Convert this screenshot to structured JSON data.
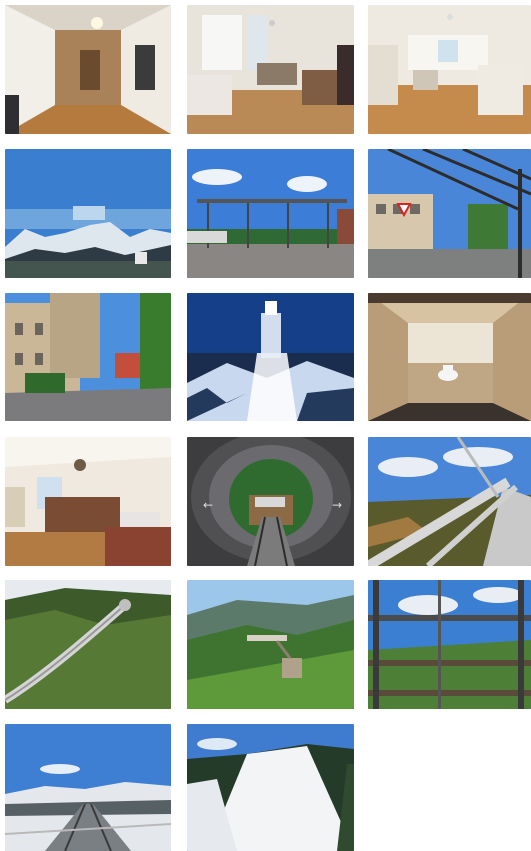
{
  "gallery": {
    "columns": 3,
    "total_photos": 17,
    "photos": [
      {
        "subject": "hallway-interior"
      },
      {
        "subject": "bedroom-interior"
      },
      {
        "subject": "kitchen-living-interior"
      },
      {
        "subject": "mountain-panorama-winter"
      },
      {
        "subject": "bus-stop-shelter"
      },
      {
        "subject": "pergola-building-street"
      },
      {
        "subject": "village-street"
      },
      {
        "subject": "observation-tower-night"
      },
      {
        "subject": "bathroom-toilet"
      },
      {
        "subject": "hotel-room-beds"
      },
      {
        "subject": "tunnel-walkway"
      },
      {
        "subject": "treetop-path-railing"
      },
      {
        "subject": "treetop-walkway-aerial"
      },
      {
        "subject": "forest-tower-aerial"
      },
      {
        "subject": "treetop-walk-spiral"
      },
      {
        "subject": "snowy-track-view"
      },
      {
        "subject": "ski-slope"
      }
    ]
  }
}
